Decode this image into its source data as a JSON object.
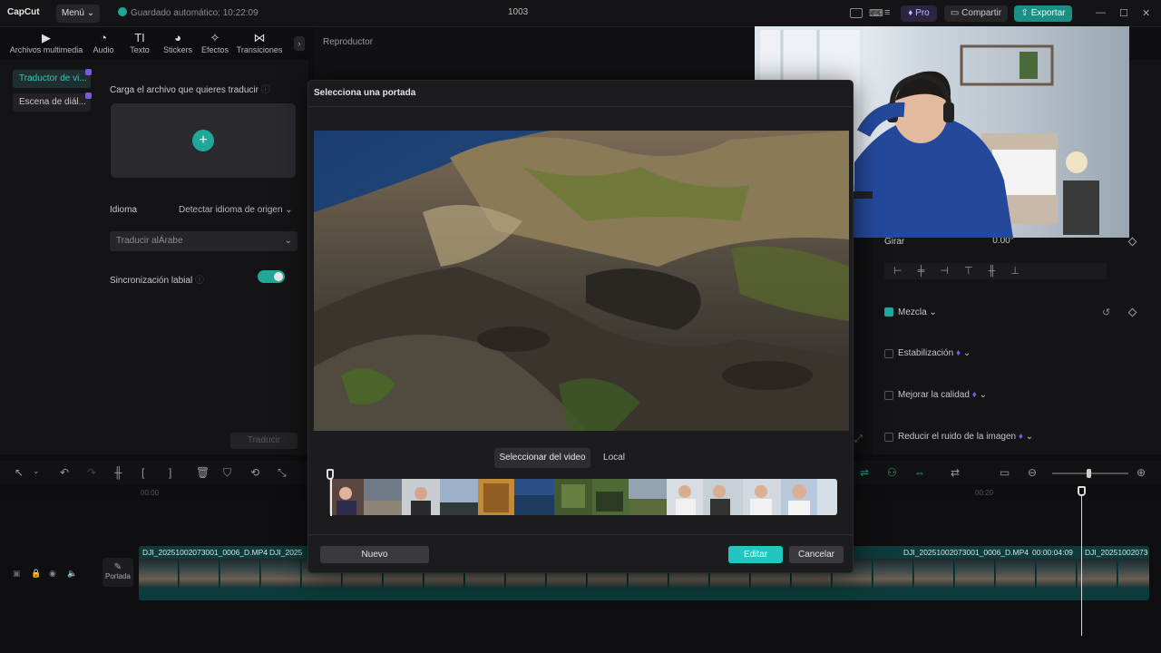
{
  "app": {
    "logo": "CapCut",
    "menu_label": "Menú",
    "autosave": "Guardado automático: 10:22:09",
    "project_title": "1003",
    "pro_label": "Pro",
    "share_label": "Compartir",
    "export_label": "Exportar",
    "accent": "#1fa89a"
  },
  "tools": {
    "tabs": [
      {
        "label": "Archivos multimedia",
        "icon": "media-icon"
      },
      {
        "label": "Audio",
        "icon": "audio-icon"
      },
      {
        "label": "Texto",
        "icon": "text-icon"
      },
      {
        "label": "Stickers",
        "icon": "sticker-icon"
      },
      {
        "label": "Efectos",
        "icon": "effects-icon"
      },
      {
        "label": "Transiciones",
        "icon": "transition-icon"
      }
    ]
  },
  "left_panel": {
    "side_items": [
      "Traductor de vi...",
      "Escena de diál..."
    ],
    "upload_label": "Carga el archivo que quieres traducir",
    "language_label": "Idioma",
    "language_value": "Detectar idioma de origen",
    "translate_to": "Traducir alÁrabe",
    "lipsync_label": "Sincronización labial",
    "translate_button": "Traducir"
  },
  "player": {
    "title": "Reproductor"
  },
  "right_panel": {
    "rotate_label": "Girar",
    "rotate_value": "0.00°",
    "blend_label": "Mezcla",
    "stabilize_label": "Estabilización",
    "quality_label": "Mejorar la calidad",
    "denoise_label": "Reducir el ruido de la imagen"
  },
  "timeline": {
    "ruler_start": "00:00",
    "ruler_mark": "00:20",
    "clip_labels": [
      "DJI_20251002073001_0006_D.MP4",
      "DJI_2025",
      "DJI_20251002073001_0006_D.MP4",
      "00:00:04:09",
      "DJI_20251002073001"
    ],
    "cover_label": "Portada"
  },
  "modal": {
    "title": "Selecciona una portada",
    "tab_video": "Seleccionar del video",
    "tab_local": "Local",
    "btn_new": "Nuevo",
    "btn_edit": "Editar",
    "btn_cancel": "Cancelar"
  }
}
